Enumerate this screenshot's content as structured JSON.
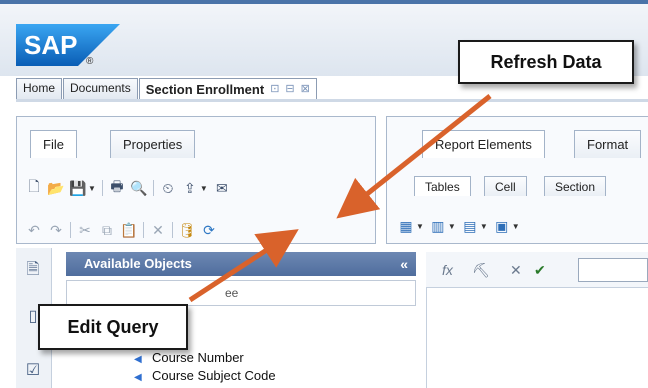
{
  "brand": {
    "logo_text": "SAP",
    "registered_mark": "®"
  },
  "doc_tabs": {
    "home": "Home",
    "documents": "Documents",
    "active": "Section Enrollment"
  },
  "left_panel": {
    "tabs": {
      "file": "File",
      "properties": "Properties"
    }
  },
  "right_panel": {
    "tabs": {
      "report_elements": "Report Elements",
      "format": "Format"
    },
    "subtabs": {
      "tables": "Tables",
      "cell": "Cell",
      "section": "Section"
    }
  },
  "objects_panel": {
    "title": "Available Objects",
    "search_text": "ee",
    "items": [
      "llment",
      "Course Number",
      "Course Subject Code"
    ]
  },
  "formula_bar": {
    "fx": "fx"
  },
  "callouts": {
    "refresh": "Refresh Data",
    "edit_query": "Edit Query"
  },
  "colors": {
    "arrow": "#d9622b",
    "header": "#5874a3"
  }
}
